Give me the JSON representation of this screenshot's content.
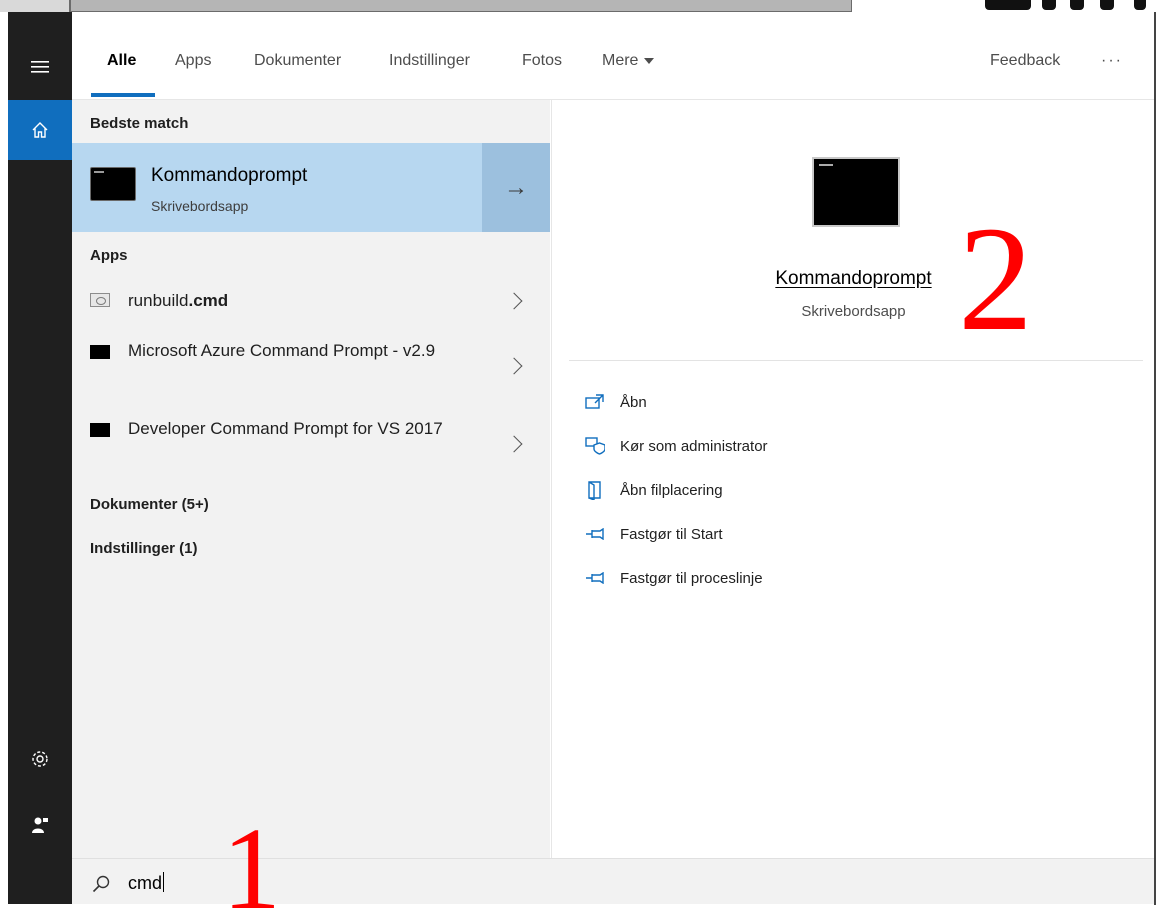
{
  "tabs": [
    {
      "label": "Alle",
      "active": true
    },
    {
      "label": "Apps",
      "active": false
    },
    {
      "label": "Dokumenter",
      "active": false
    },
    {
      "label": "Indstillinger",
      "active": false
    },
    {
      "label": "Fotos",
      "active": false
    },
    {
      "label": "Mere",
      "active": false
    }
  ],
  "header": {
    "feedback_label": "Feedback",
    "more_label": "···"
  },
  "results": {
    "best_match_heading": "Bedste match",
    "best_match": {
      "title": "Kommandoprompt",
      "subtitle": "Skrivebordsapp",
      "arrow": "→"
    },
    "apps_heading": "Apps",
    "apps": [
      {
        "name_plain": "runbuild",
        "name_bold": ".cmd",
        "icon": "script-file-icon"
      },
      {
        "name_plain": "Microsoft Azure Command Prompt - v2.9",
        "name_bold": "",
        "icon": "console-icon"
      },
      {
        "name_plain": "Developer Command Prompt for VS 2017",
        "name_bold": "",
        "icon": "console-icon"
      }
    ],
    "documents_heading": "Dokumenter (5+)",
    "settings_heading": "Indstillinger (1)"
  },
  "search": {
    "value": "cmd"
  },
  "detail": {
    "title": "Kommandoprompt",
    "subtitle": "Skrivebordsapp",
    "actions": [
      {
        "label": "Åbn",
        "icon": "open-icon"
      },
      {
        "label": "Kør som administrator",
        "icon": "run-as-admin-icon"
      },
      {
        "label": "Åbn filplacering",
        "icon": "file-location-icon"
      },
      {
        "label": "Fastgør til Start",
        "icon": "pin-icon"
      },
      {
        "label": "Fastgør til proceslinje",
        "icon": "pin-icon"
      }
    ]
  },
  "annotations": {
    "step1": "1",
    "step2": "2"
  },
  "colors": {
    "accent": "#106ebe",
    "selection": "#b7d7f0",
    "rail": "#1f1f1f",
    "annotation": "#ff0000"
  }
}
